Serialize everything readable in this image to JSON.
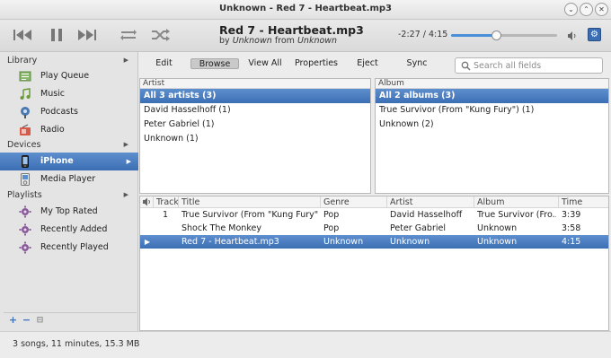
{
  "window": {
    "title": "Unknown - Red 7 - Heartbeat.mp3"
  },
  "player": {
    "song_title": "Red 7 - Heartbeat.mp3",
    "by_prefix": "by",
    "artist": "Unknown",
    "from_prefix": "from",
    "album": "Unknown",
    "time_display": "-2:27 / 4:15",
    "progress_fraction": 0.42
  },
  "sidebar": {
    "library_label": "Library",
    "library_items": [
      {
        "label": "Play Queue",
        "icon": "play-queue-icon"
      },
      {
        "label": "Music",
        "icon": "music-note-icon"
      },
      {
        "label": "Podcasts",
        "icon": "podcast-icon"
      },
      {
        "label": "Radio",
        "icon": "radio-icon"
      }
    ],
    "devices_label": "Devices",
    "device_items": [
      {
        "label": "iPhone",
        "icon": "iphone-icon",
        "selected": true
      },
      {
        "label": "Media Player",
        "icon": "media-player-icon"
      }
    ],
    "playlists_label": "Playlists",
    "playlist_items": [
      {
        "label": "My Top Rated",
        "icon": "smart-playlist-icon"
      },
      {
        "label": "Recently Added",
        "icon": "smart-playlist-icon"
      },
      {
        "label": "Recently Played",
        "icon": "smart-playlist-icon"
      }
    ]
  },
  "nav": {
    "items": [
      "Edit",
      "Browse",
      "View All",
      "Properties",
      "Eject",
      "Sync"
    ],
    "selected": "Browse",
    "search_placeholder": "Search all fields"
  },
  "browser": {
    "artist_header": "Artist",
    "artists": [
      "All 3 artists (3)",
      "David Hasselhoff (1)",
      "Peter Gabriel (1)",
      "Unknown (1)"
    ],
    "album_header": "Album",
    "albums": [
      "All 2 albums (3)",
      "True Survivor (From \"Kung Fury\") (1)",
      "Unknown (2)"
    ]
  },
  "tracks": {
    "columns": [
      "Track",
      "Title",
      "Genre",
      "Artist",
      "Album",
      "Time"
    ],
    "rows": [
      {
        "track": "1",
        "title": "True Survivor (From \"Kung Fury\")",
        "genre": "Pop",
        "artist": "David Hasselhoff",
        "album": "True Survivor (Fro...",
        "time": "3:39"
      },
      {
        "track": "",
        "title": "Shock The Monkey",
        "genre": "Pop",
        "artist": "Peter Gabriel",
        "album": "Unknown",
        "time": "3:58"
      },
      {
        "track": "▶",
        "title": "Red 7 - Heartbeat.mp3",
        "genre": "Unknown",
        "artist": "Unknown",
        "album": "Unknown",
        "time": "4:15"
      }
    ]
  },
  "status": {
    "text": "3 songs, 11 minutes, 15.3 MB"
  },
  "colors": {
    "selection": "#4a7fc1",
    "accent": "#4a90d9"
  }
}
